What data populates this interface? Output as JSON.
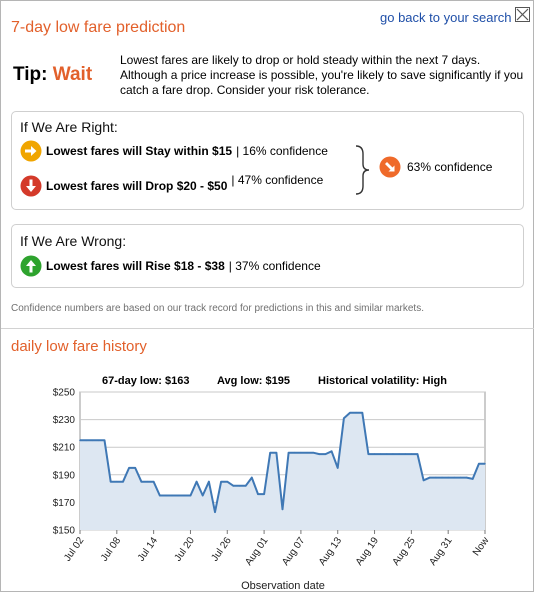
{
  "header": {
    "title": "7-day low fare prediction",
    "go_back_link": "go back to your search",
    "close_icon": "close-icon"
  },
  "tip": {
    "label": "Tip:",
    "value": "Wait",
    "text": "Lowest fares are likely to drop or hold steady within the next 7 days. Although a price increase is possible, you're likely to save significantly if you catch a fare drop. Consider your risk tolerance."
  },
  "right_box": {
    "heading": "If We Are Right:",
    "rows": [
      {
        "icon": "arrow-right-icon",
        "text": "Lowest fares will Stay within $15",
        "confidence": "| 16% confidence"
      },
      {
        "icon": "arrow-down-icon",
        "text": "Lowest fares will Drop $20 - $50",
        "confidence": "| 47% confidence"
      }
    ],
    "aggregate": {
      "icon": "arrow-down-right-icon",
      "text": "63% confidence"
    }
  },
  "wrong_box": {
    "heading": "If We Are Wrong:",
    "rows": [
      {
        "icon": "arrow-up-icon",
        "text": "Lowest fares will Rise $18 - $38",
        "confidence": "| 37% confidence"
      }
    ]
  },
  "footnote": "Confidence numbers are based on our track record for predictions in this and similar markets.",
  "history": {
    "title": "daily low fare history",
    "stats": {
      "low": "67-day low: $163",
      "avg": "Avg low: $195",
      "volatility": "Historical volatility: High"
    }
  },
  "colors": {
    "accent": "#e2602b",
    "link": "#1f4fa8",
    "line": "#3f78b5",
    "area": "#dde7f2",
    "icon_right": "#f0a500",
    "icon_down": "#d43a2a",
    "icon_up": "#2ea32e",
    "icon_agg": "#ef6a2a"
  },
  "chart_data": {
    "type": "area",
    "xlabel": "Observation date",
    "ylabel": "",
    "ylim": [
      150,
      250
    ],
    "yticks": [
      150,
      170,
      190,
      210,
      230,
      250
    ],
    "ytick_labels": [
      "$150",
      "$170",
      "$190",
      "$210",
      "$230",
      "$250"
    ],
    "xticks": [
      0,
      6,
      12,
      18,
      24,
      30,
      36,
      42,
      48,
      54,
      60,
      66
    ],
    "xtick_labels": [
      "Jul 02",
      "Jul 08",
      "Jul 14",
      "Jul 20",
      "Jul 26",
      "Aug 01",
      "Aug 07",
      "Aug 13",
      "Aug 19",
      "Aug 25",
      "Aug 31",
      "Now"
    ],
    "x": [
      0,
      1,
      2,
      3,
      4,
      5,
      6,
      7,
      8,
      9,
      10,
      11,
      12,
      13,
      14,
      15,
      16,
      17,
      18,
      19,
      20,
      21,
      22,
      23,
      24,
      25,
      26,
      27,
      28,
      29,
      30,
      31,
      32,
      33,
      34,
      35,
      36,
      37,
      38,
      39,
      40,
      41,
      42,
      43,
      44,
      45,
      46,
      47,
      48,
      49,
      50,
      51,
      52,
      53,
      54,
      55,
      56,
      57,
      58,
      59,
      60,
      61,
      62,
      63,
      64,
      65,
      66
    ],
    "values": [
      215,
      215,
      215,
      215,
      215,
      185,
      185,
      185,
      195,
      195,
      185,
      185,
      185,
      175,
      175,
      175,
      175,
      175,
      175,
      185,
      175,
      185,
      163,
      185,
      185,
      182,
      182,
      182,
      188,
      176,
      176,
      206,
      206,
      165,
      206,
      206,
      206,
      206,
      206,
      205,
      205,
      207,
      195,
      231,
      235,
      235,
      235,
      205,
      205,
      205,
      205,
      205,
      205,
      205,
      205,
      205,
      186,
      188,
      188,
      188,
      188,
      188,
      188,
      188,
      187,
      198,
      198
    ],
    "grid": true,
    "legend": "none"
  }
}
